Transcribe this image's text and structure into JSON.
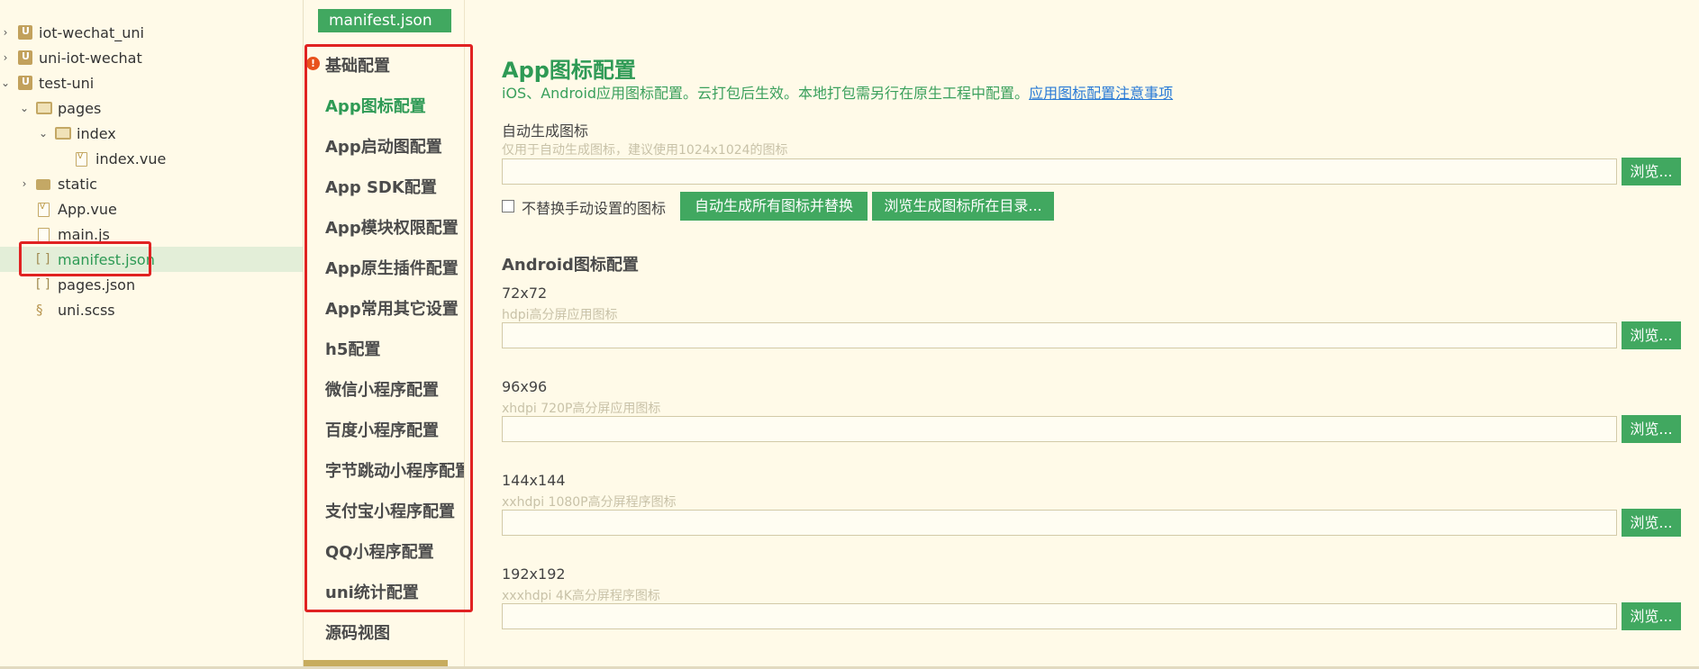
{
  "tree": {
    "items": [
      {
        "label": "iot-wechat_uni",
        "chevron": "›",
        "icon": "project-icon"
      },
      {
        "label": "uni-iot-wechat",
        "chevron": "›",
        "icon": "project-icon"
      },
      {
        "label": "test-uni",
        "chevron": "⌄",
        "icon": "project-icon"
      },
      {
        "label": "pages",
        "chevron": "⌄",
        "icon": "folder-open-icon"
      },
      {
        "label": "index",
        "chevron": "⌄",
        "icon": "folder-open-icon"
      },
      {
        "label": "index.vue",
        "chevron": "",
        "icon": "vue-file-icon"
      },
      {
        "label": "static",
        "chevron": "›",
        "icon": "folder-icon"
      },
      {
        "label": "App.vue",
        "chevron": "",
        "icon": "vue-file-icon"
      },
      {
        "label": "main.js",
        "chevron": "",
        "icon": "js-file-icon"
      },
      {
        "label": "manifest.json",
        "chevron": "",
        "icon": "json-file-icon",
        "selected": true
      },
      {
        "label": "pages.json",
        "chevron": "",
        "icon": "json-file-icon"
      },
      {
        "label": "uni.scss",
        "chevron": "",
        "icon": "scss-file-icon"
      }
    ]
  },
  "nav": {
    "file_tab": "manifest.json",
    "warning_glyph": "!",
    "items": [
      "基础配置",
      "App图标配置",
      "App启动图配置",
      "App SDK配置",
      "App模块权限配置",
      "App原生插件配置",
      "App常用其它设置",
      "h5配置",
      "微信小程序配置",
      "百度小程序配置",
      "字节跳动小程序配置",
      "支付宝小程序配置",
      "QQ小程序配置",
      "uni统计配置",
      "源码视图"
    ],
    "active_index": 1
  },
  "main": {
    "title": "App图标配置",
    "description": "iOS、Android应用图标配置。云打包后生效。本地打包需另行在原生工程中配置。",
    "description_link": "应用图标配置注意事项",
    "auto": {
      "label": "自动生成图标",
      "hint": "仅用于自动生成图标，建议使用1024x1024的图标",
      "value": "",
      "browse": "浏览...",
      "checkbox_label": "不替换手动设置的图标",
      "checkbox_checked": false,
      "generate_button": "自动生成所有图标并替换",
      "open_dir_button": "浏览生成图标所在目录..."
    },
    "android_title": "Android图标配置",
    "icons": [
      {
        "size": "72x72",
        "hint": "hdpi高分屏应用图标",
        "value": "",
        "browse": "浏览..."
      },
      {
        "size": "96x96",
        "hint": "xhdpi 720P高分屏应用图标",
        "value": "",
        "browse": "浏览..."
      },
      {
        "size": "144x144",
        "hint": "xxhdpi 1080P高分屏程序图标",
        "value": "",
        "browse": "浏览..."
      },
      {
        "size": "192x192",
        "hint": "xxxhdpi 4K高分屏程序图标",
        "value": "",
        "browse": "浏览..."
      }
    ]
  },
  "colors": {
    "accent_green": "#41a860",
    "title_green": "#2e9a55",
    "background": "#fffae8",
    "highlight_red": "#e02222",
    "link_blue": "#2a7bd6",
    "warning_orange": "#e8521d"
  }
}
